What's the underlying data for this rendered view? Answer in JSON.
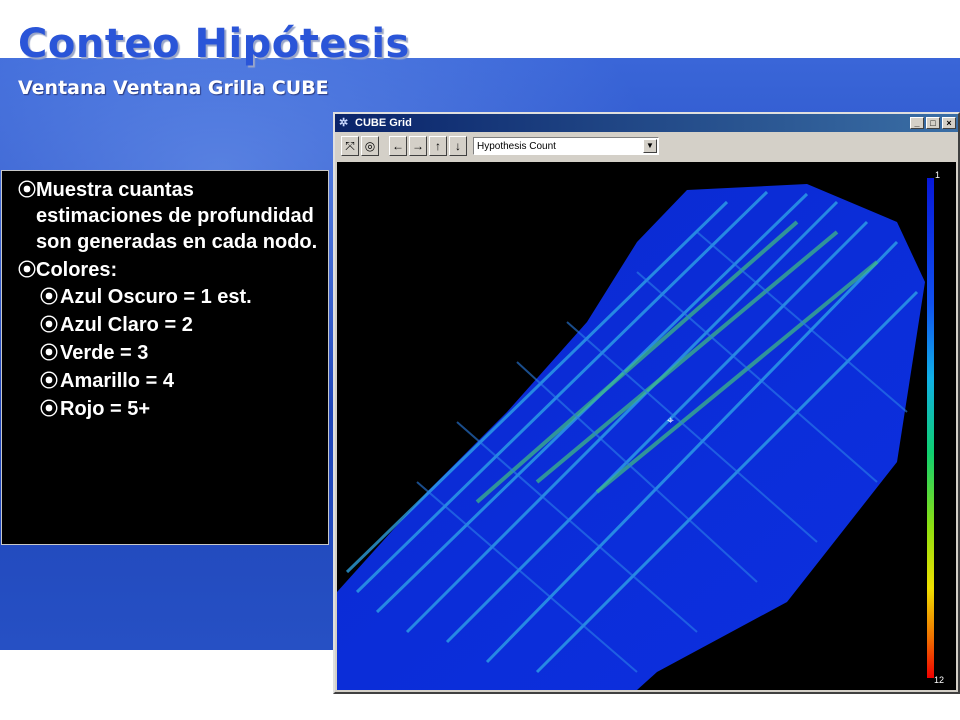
{
  "slide": {
    "title": "Conteo Hipótesis",
    "subtitle": "Ventana Ventana Grilla CUBE"
  },
  "textbox": {
    "bullet_symbol": "⦿",
    "items": [
      {
        "text": "Muestra cuantas estimaciones de profundidad son generadas en cada nodo.",
        "level": 1
      },
      {
        "text": "Colores:",
        "level": 1
      },
      {
        "text": "Azul Oscuro = 1 est.",
        "level": 2
      },
      {
        "text": "Azul Claro = 2",
        "level": 2
      },
      {
        "text": "Verde = 3",
        "level": 2
      },
      {
        "text": "Amarillo = 4",
        "level": 2
      },
      {
        "text": "Rojo = 5+",
        "level": 2
      }
    ]
  },
  "window": {
    "title": "CUBE Grid",
    "controls": [
      "_",
      "□",
      "×"
    ],
    "toolbar": {
      "icons": [
        "zoom-icon",
        "target-icon",
        "arrow-left-icon",
        "arrow-right-icon",
        "arrow-up-icon",
        "arrow-down-icon"
      ],
      "select_value": "Hypothesis Count"
    },
    "legend": {
      "min_label": "1",
      "max_label": "12"
    }
  },
  "colors": {
    "title": "#2a55d8",
    "background": "#2a52c8",
    "survey_dark_blue": "#1030d0",
    "survey_light_blue": "#30a0e0",
    "survey_green": "#30c060"
  }
}
